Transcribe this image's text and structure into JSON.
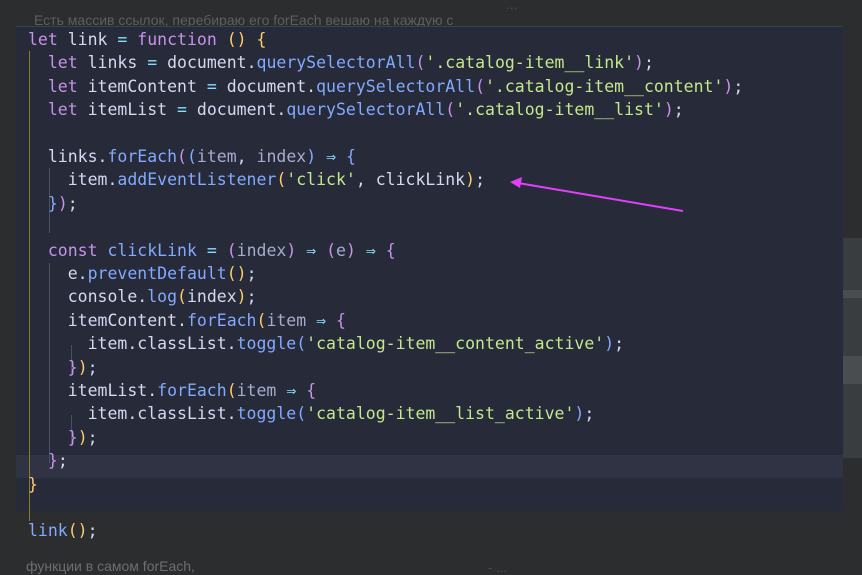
{
  "background": {
    "top_text": "Есть массив ссылок, перебираю его forEach вешаю на каждую с",
    "top_dots": "...",
    "bottom_text": "функции в самом forEach,",
    "bottom_right_text": "- ..."
  },
  "code_lines": [
    [
      [
        "kw",
        "let"
      ],
      [
        "pl",
        " link "
      ],
      [
        "op",
        "="
      ],
      [
        "pl",
        " "
      ],
      [
        "kw",
        "function"
      ],
      [
        "pl",
        " "
      ],
      [
        "par",
        "()"
      ],
      [
        "pl",
        " "
      ],
      [
        "par",
        "{"
      ]
    ],
    [
      [
        "pl",
        "  "
      ],
      [
        "kw",
        "let"
      ],
      [
        "pl",
        " links "
      ],
      [
        "op",
        "="
      ],
      [
        "pl",
        " document."
      ],
      [
        "fn",
        "querySelectorAll"
      ],
      [
        "par2",
        "("
      ],
      [
        "str",
        "'.catalog-item__link'"
      ],
      [
        "par2",
        ")"
      ],
      [
        "pl",
        ";"
      ]
    ],
    [
      [
        "pl",
        "  "
      ],
      [
        "kw",
        "let"
      ],
      [
        "pl",
        " itemContent "
      ],
      [
        "op",
        "="
      ],
      [
        "pl",
        " document."
      ],
      [
        "fn",
        "querySelectorAll"
      ],
      [
        "par2",
        "("
      ],
      [
        "str",
        "'.catalog-item__content'"
      ],
      [
        "par2",
        ")"
      ],
      [
        "pl",
        ";"
      ]
    ],
    [
      [
        "pl",
        "  "
      ],
      [
        "kw",
        "let"
      ],
      [
        "pl",
        " itemList "
      ],
      [
        "op",
        "="
      ],
      [
        "pl",
        " document."
      ],
      [
        "fn",
        "querySelectorAll"
      ],
      [
        "par2",
        "("
      ],
      [
        "str",
        "'.catalog-item__list'"
      ],
      [
        "par2",
        ")"
      ],
      [
        "pl",
        ";"
      ]
    ],
    [],
    [
      [
        "pl",
        "  links."
      ],
      [
        "fn",
        "forEach"
      ],
      [
        "par2",
        "("
      ],
      [
        "par3",
        "("
      ],
      [
        "arg",
        "item"
      ],
      [
        "pl",
        ", "
      ],
      [
        "arg",
        "index"
      ],
      [
        "par3",
        ")"
      ],
      [
        "pl",
        " "
      ],
      [
        "op",
        "⇒"
      ],
      [
        "pl",
        " "
      ],
      [
        "par3",
        "{"
      ]
    ],
    [
      [
        "pl",
        "    item."
      ],
      [
        "fn",
        "addEventListener"
      ],
      [
        "par",
        "("
      ],
      [
        "str",
        "'click'"
      ],
      [
        "pl",
        ", clickLink"
      ],
      [
        "par",
        ")"
      ],
      [
        "pl",
        ";"
      ]
    ],
    [
      [
        "pl",
        "  "
      ],
      [
        "par3",
        "}"
      ],
      [
        "par2",
        ")"
      ],
      [
        "pl",
        ";"
      ]
    ],
    [],
    [
      [
        "pl",
        "  "
      ],
      [
        "kw",
        "const"
      ],
      [
        "pl",
        " "
      ],
      [
        "fn",
        "clickLink"
      ],
      [
        "pl",
        " "
      ],
      [
        "op",
        "="
      ],
      [
        "pl",
        " "
      ],
      [
        "par2",
        "("
      ],
      [
        "arg",
        "index"
      ],
      [
        "par2",
        ")"
      ],
      [
        "pl",
        " "
      ],
      [
        "op",
        "⇒"
      ],
      [
        "pl",
        " "
      ],
      [
        "par2",
        "("
      ],
      [
        "arg",
        "e"
      ],
      [
        "par2",
        ")"
      ],
      [
        "pl",
        " "
      ],
      [
        "op",
        "⇒"
      ],
      [
        "pl",
        " "
      ],
      [
        "par2",
        "{"
      ]
    ],
    [
      [
        "pl",
        "    e."
      ],
      [
        "fn",
        "preventDefault"
      ],
      [
        "par",
        "()"
      ],
      [
        "pl",
        ";"
      ]
    ],
    [
      [
        "pl",
        "    console."
      ],
      [
        "fn",
        "log"
      ],
      [
        "par",
        "("
      ],
      [
        "pl",
        "index"
      ],
      [
        "par",
        ")"
      ],
      [
        "pl",
        ";"
      ]
    ],
    [
      [
        "pl",
        "    itemContent."
      ],
      [
        "fn",
        "forEach"
      ],
      [
        "par",
        "("
      ],
      [
        "arg",
        "item"
      ],
      [
        "pl",
        " "
      ],
      [
        "op",
        "⇒"
      ],
      [
        "pl",
        " "
      ],
      [
        "par2",
        "{"
      ]
    ],
    [
      [
        "pl",
        "      item.classList."
      ],
      [
        "fn",
        "toggle"
      ],
      [
        "par3",
        "("
      ],
      [
        "str",
        "'catalog-item__content_active'"
      ],
      [
        "par3",
        ")"
      ],
      [
        "pl",
        ";"
      ]
    ],
    [
      [
        "pl",
        "    "
      ],
      [
        "par2",
        "}"
      ],
      [
        "par",
        ")"
      ],
      [
        "pl",
        ";"
      ]
    ],
    [
      [
        "pl",
        "    itemList."
      ],
      [
        "fn",
        "forEach"
      ],
      [
        "par",
        "("
      ],
      [
        "arg",
        "item"
      ],
      [
        "pl",
        " "
      ],
      [
        "op",
        "⇒"
      ],
      [
        "pl",
        " "
      ],
      [
        "par2",
        "{"
      ]
    ],
    [
      [
        "pl",
        "      item.classList."
      ],
      [
        "fn",
        "toggle"
      ],
      [
        "par3",
        "("
      ],
      [
        "str",
        "'catalog-item__list_active'"
      ],
      [
        "par3",
        ")"
      ],
      [
        "pl",
        ";"
      ]
    ],
    [
      [
        "pl",
        "    "
      ],
      [
        "par2",
        "}"
      ],
      [
        "par",
        ")"
      ],
      [
        "pl",
        ";"
      ]
    ],
    [
      [
        "pl",
        "  "
      ],
      [
        "par2",
        "}"
      ],
      [
        "pl",
        ";"
      ]
    ],
    [
      [
        "par",
        "}"
      ]
    ],
    [],
    [
      [
        "fn",
        "link"
      ],
      [
        "par",
        "()"
      ],
      [
        "pl",
        ";"
      ]
    ]
  ],
  "colors": {
    "editor_bg": "#262a39",
    "keyword": "#c792ea",
    "function": "#82aaff",
    "string": "#c3e88d",
    "annotation_arrow": "#e040fb"
  }
}
